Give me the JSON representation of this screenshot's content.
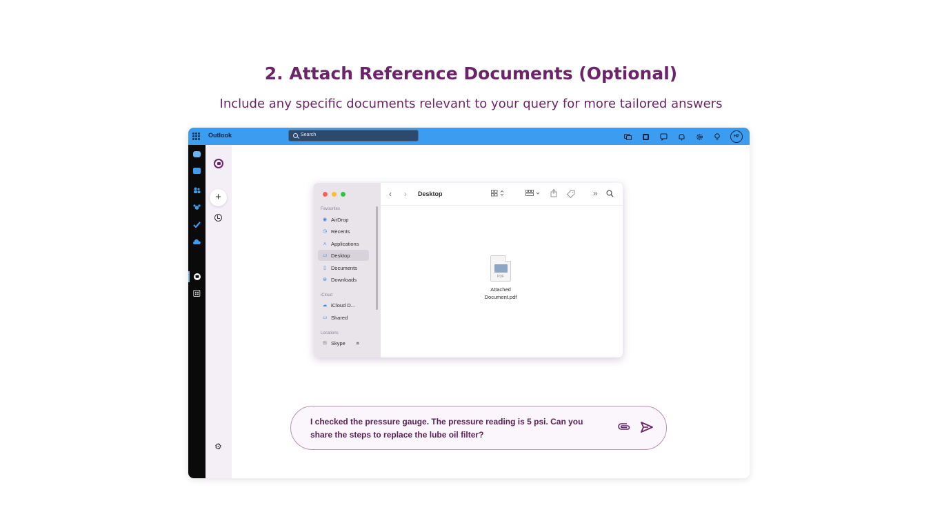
{
  "heading": "2. Attach Reference Documents (Optional)",
  "subheading": "Include any specific documents relevant to your query for more tailored answers",
  "outlook": {
    "app_name": "Outlook",
    "search_placeholder": "Search",
    "avatar_initials": "HP",
    "top_icons": [
      "meet-icon",
      "teams-icon",
      "feedback-icon",
      "bell-icon",
      "gear-icon",
      "lightbulb-icon"
    ],
    "rail_icons": [
      "mail-icon",
      "calendar-icon",
      "people-icon",
      "groups-icon",
      "todo-icon",
      "onedrive-icon",
      "copilot-icon",
      "apps-icon"
    ],
    "colors": {
      "topbar": "#3c9df0",
      "rail": "#0a0a0a",
      "brand": "#6b2468"
    }
  },
  "finder": {
    "title": "Desktop",
    "sections": {
      "favourites": "Favourites",
      "icloud": "iCloud",
      "locations": "Locations"
    },
    "favourites": [
      "AirDrop",
      "Recents",
      "Applications",
      "Desktop",
      "Documents",
      "Downloads"
    ],
    "icloud_items": [
      "iCloud D...",
      "Shared"
    ],
    "location_items": [
      "Skype"
    ],
    "selected": "Desktop",
    "file": {
      "name_line1": "Attached",
      "name_line2": "Document.pdf",
      "type_tag": "PDF"
    }
  },
  "chat": {
    "message": "I checked the pressure gauge. The pressure reading is 5 psi. Can you share the steps to replace the lube oil filter?"
  }
}
